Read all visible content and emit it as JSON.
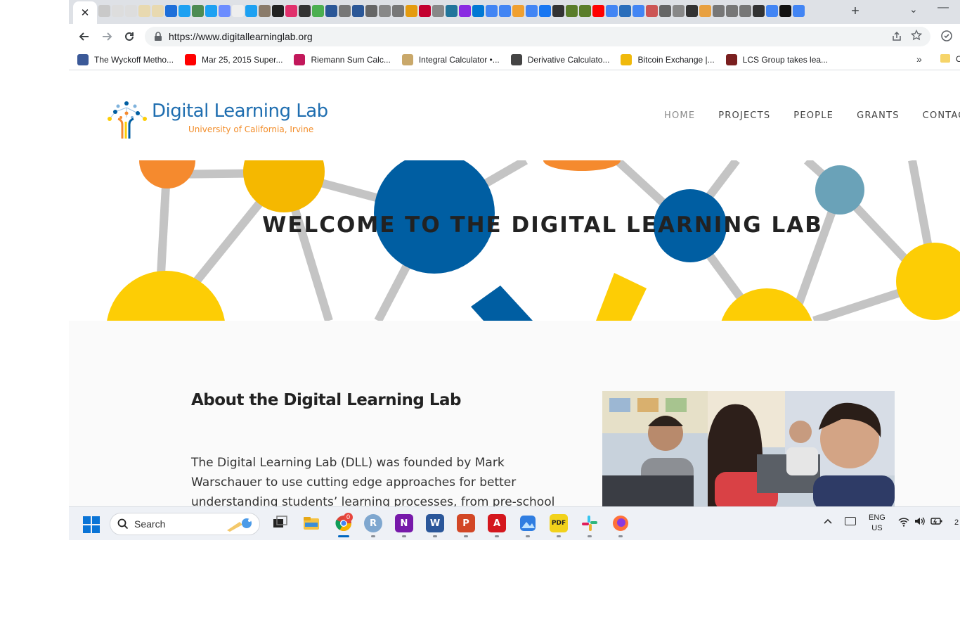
{
  "browser": {
    "active_tab_close": "✕",
    "new_tab": "+",
    "tab_search": "⌄",
    "minimize": "—",
    "pinned_tab_colors": [
      "#c9c9c9",
      "#ddd",
      "#ddd",
      "#e8d9b0",
      "#e8d9b0",
      "#1e6fd9",
      "#1da1f2",
      "#4d8b52",
      "#1da1f2",
      "#6b8cff",
      "#eee",
      "#1da1f2",
      "#8a7b6a",
      "#222",
      "#e1306c",
      "#333",
      "#4caf50",
      "#2b5797",
      "#777",
      "#2b5797",
      "#666",
      "#888",
      "#777",
      "#e49b0f",
      "#c3002f",
      "#888",
      "#21759b",
      "#8a2be2",
      "#0078d4",
      "#4285f4",
      "#4285f4",
      "#f0a030",
      "#4285f4",
      "#1877f2",
      "#333",
      "#5a7d2a",
      "#5a7d2a",
      "#ff0000",
      "#4285f4",
      "#2a6ebb",
      "#4285f4",
      "#c55",
      "#666",
      "#888",
      "#333",
      "#e8a040",
      "#777",
      "#777",
      "#777",
      "#333",
      "#4285f4",
      "#111",
      "#4285f4"
    ],
    "url": "https://www.digitallearninglab.org"
  },
  "bookmarks": [
    {
      "label": "The Wyckoff Metho...",
      "color": "#3b5998"
    },
    {
      "label": "Mar 25, 2015 Super...",
      "color": "#ff0000"
    },
    {
      "label": "Riemann Sum Calc...",
      "color": "#c2185b"
    },
    {
      "label": "Integral Calculator •...",
      "color": "#c9a86a"
    },
    {
      "label": "Derivative Calculato...",
      "color": "#444"
    },
    {
      "label": "Bitcoin Exchange |...",
      "color": "#f0b90b"
    },
    {
      "label": "LCS Group takes lea...",
      "color": "#7a1f1f"
    }
  ],
  "bookmarks_more": "»",
  "bookmarks_folder_label": "C",
  "site": {
    "logo_title": "Digital Learning Lab",
    "logo_subtitle": "University of California, Irvine",
    "nav": [
      "HOME",
      "PROJECTS",
      "PEOPLE",
      "GRANTS",
      "CONTACT"
    ],
    "hero_title": "WELCOME TO THE DIGITAL LEARNING LAB",
    "about_heading": "About the Digital Learning Lab",
    "about_text": "The Digital Learning Lab (DLL) was founded by Mark Warschauer to use cutting edge approaches for better understanding students’ learning processes, from pre-school"
  },
  "colors": {
    "brand_blue": "#005ea2",
    "brand_orange": "#f58a2e",
    "brand_yellow": "#fdcd05",
    "line_grey": "#c4c4c4"
  },
  "taskbar": {
    "search_label": "Search",
    "chrome_badge": "0",
    "lang_top": "ENG",
    "lang_bottom": "US",
    "clock": "2",
    "apps": [
      {
        "name": "file-explorer",
        "label": ""
      },
      {
        "name": "chrome",
        "label": ""
      },
      {
        "name": "r-app",
        "label": "R"
      },
      {
        "name": "onenote",
        "label": "N"
      },
      {
        "name": "word",
        "label": "W"
      },
      {
        "name": "powerpoint",
        "label": "P"
      },
      {
        "name": "acrobat",
        "label": "A"
      },
      {
        "name": "photos",
        "label": ""
      },
      {
        "name": "pdf-app",
        "label": "PDF"
      },
      {
        "name": "slack",
        "label": ""
      },
      {
        "name": "firefox",
        "label": ""
      }
    ]
  }
}
